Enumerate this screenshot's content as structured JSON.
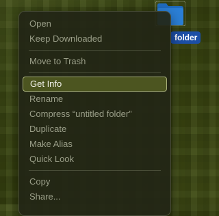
{
  "desktop": {
    "folder_icon": "folder-icon",
    "folder_label": "folder",
    "folder_color": "#2b7fd6",
    "label_highlight_color": "#1c4fa6"
  },
  "context_menu": {
    "items": [
      {
        "label": "Open"
      },
      {
        "label": "Keep Downloaded"
      },
      {
        "label": "Move to Trash"
      },
      {
        "label": "Get Info",
        "highlighted": true
      },
      {
        "label": "Rename"
      },
      {
        "label": "Compress “untitled folder”"
      },
      {
        "label": "Duplicate"
      },
      {
        "label": "Make Alias"
      },
      {
        "label": "Quick Look"
      },
      {
        "label": "Copy"
      },
      {
        "label": "Share..."
      }
    ],
    "highlight_color": "#4c5520"
  }
}
